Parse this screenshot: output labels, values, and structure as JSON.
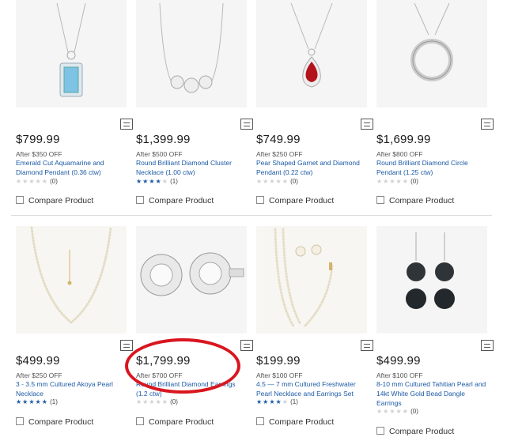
{
  "compare_label": "Compare Product",
  "products": [
    {
      "price": "$799.99",
      "discount": "After $350 OFF",
      "name": "Emerald Cut Aquamarine and Diamond Pendant (0.36 ctw)",
      "stars": 0,
      "reviews": "(0)",
      "image": "aquamarine-pendant"
    },
    {
      "price": "$1,399.99",
      "discount": "After $500 OFF",
      "name": "Round Brilliant Diamond Cluster Necklace (1.00 ctw)",
      "stars": 4,
      "reviews": "(1)",
      "image": "diamond-cluster-necklace"
    },
    {
      "price": "$749.99",
      "discount": "After $250 OFF",
      "name": "Pear Shaped Garnet and Diamond Pendant (0.22 ctw)",
      "stars": 0,
      "reviews": "(0)",
      "image": "garnet-pendant"
    },
    {
      "price": "$1,699.99",
      "discount": "After $800 OFF",
      "name": "Round Brilliant Diamond Circle Pendant (1.25 ctw)",
      "stars": 0,
      "reviews": "(0)",
      "image": "diamond-circle-pendant"
    },
    {
      "price": "$499.99",
      "discount": "After $250 OFF",
      "name": "3 - 3.5 mm Cultured Akoya Pearl Necklace",
      "stars": 5,
      "reviews": "(1)",
      "image": "akoya-pearl-necklace"
    },
    {
      "price": "$1,799.99",
      "discount": "After $700 OFF",
      "name": "Round Brilliant Diamond Earrings (1.2 ctw)",
      "stars": 0,
      "reviews": "(0)",
      "image": "diamond-earrings"
    },
    {
      "price": "$199.99",
      "discount": "After $100 OFF",
      "name": "4.5 — 7 mm Cultured Freshwater Pearl Necklace and Earrings Set",
      "stars": 4,
      "reviews": "(1)",
      "image": "freshwater-pearl-set"
    },
    {
      "price": "$499.99",
      "discount": "After $100 OFF",
      "name": "8-10 mm Cultured Tahitian Pearl and 14kt White Gold Bead Dangle Earrings",
      "stars": 0,
      "reviews": "(0)",
      "image": "tahitian-pearl-earrings"
    }
  ],
  "colors": {
    "link": "#1c5aa5",
    "star_on": "#1c5aa5",
    "star_off": "#d0d0d0",
    "highlight": "#d9161f"
  },
  "annotation": "red-circle-highlight"
}
